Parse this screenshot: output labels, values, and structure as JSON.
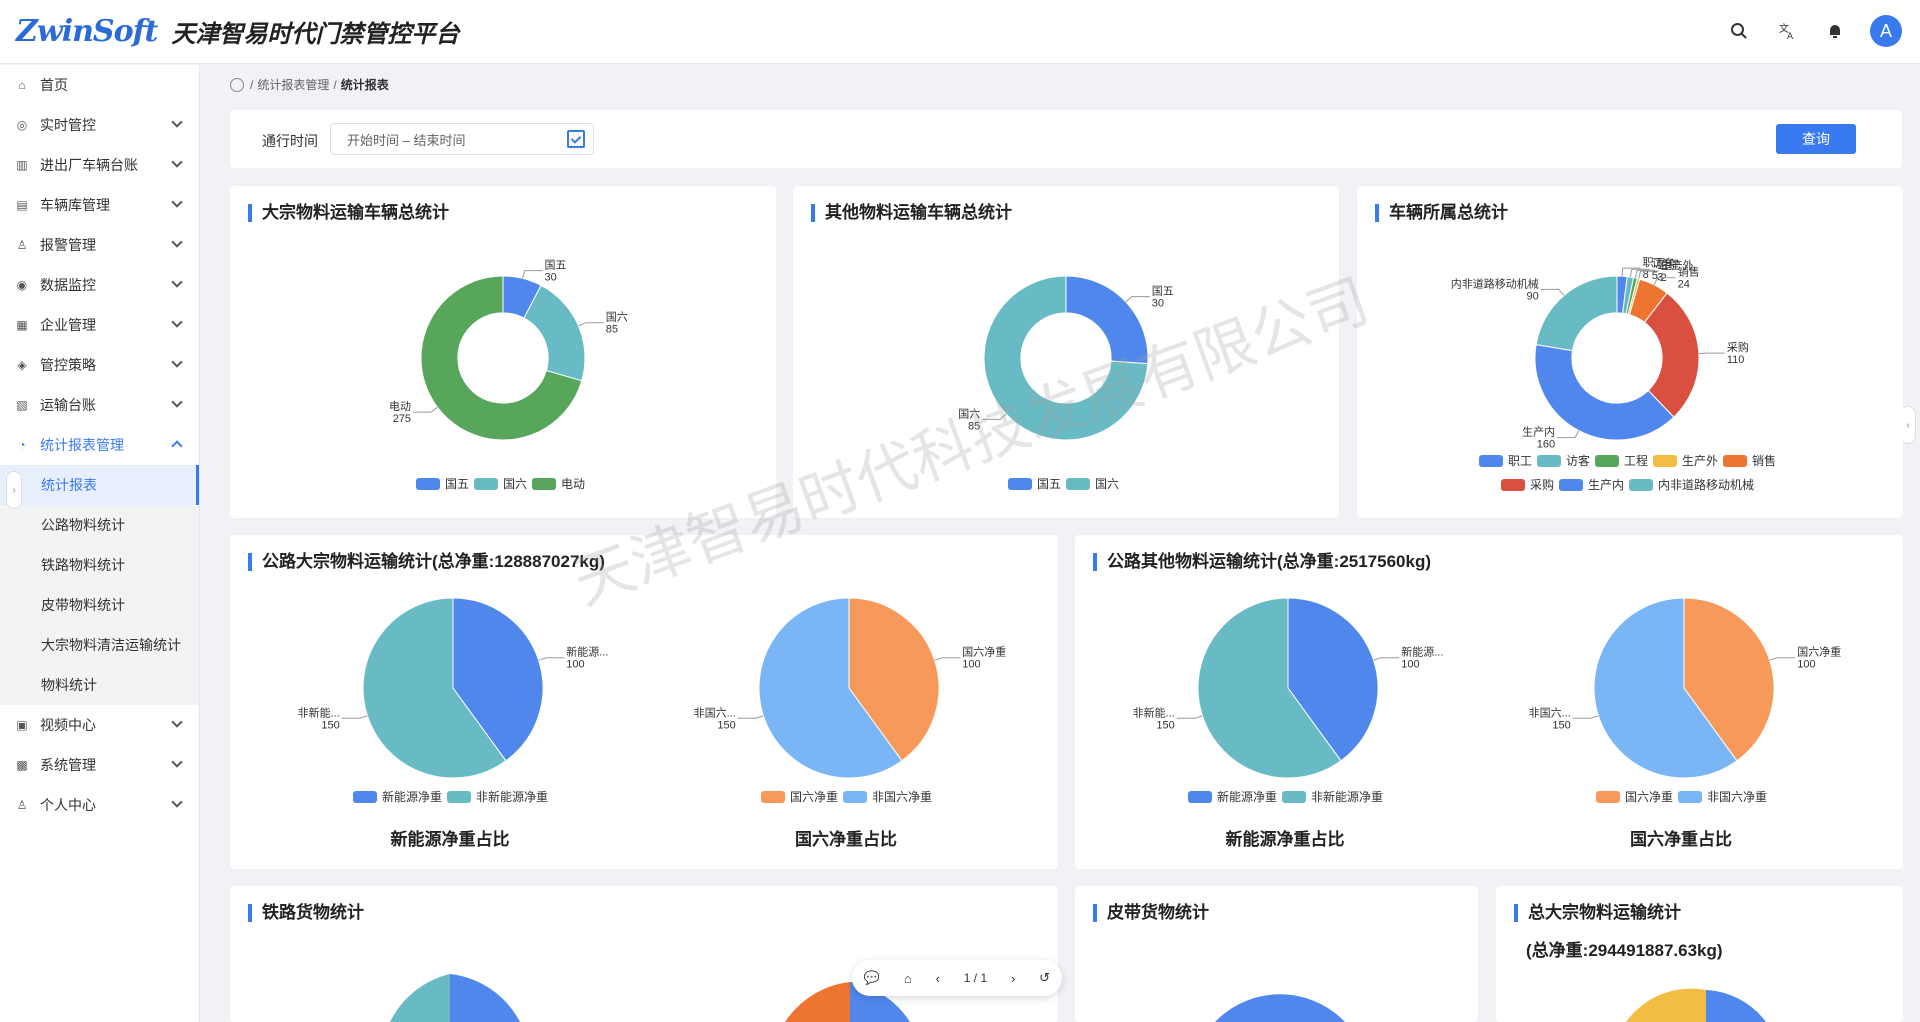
{
  "header": {
    "logo_text": "ZwinSoft",
    "title": "天津智易时代门禁管控平台",
    "avatar_letter": "A",
    "actions": [
      {
        "name": "search-icon",
        "glyph": "⌕"
      },
      {
        "name": "translate-icon",
        "glyph": "文"
      },
      {
        "name": "bell-icon",
        "glyph": "♪"
      }
    ]
  },
  "sidebar": {
    "items": [
      {
        "label": "首页",
        "icon": "⌂",
        "icon_name": "home-icon",
        "has_children": false
      },
      {
        "label": "实时管控",
        "icon": "◎",
        "icon_name": "monitor-icon",
        "has_children": true
      },
      {
        "label": "进出厂车辆台账",
        "icon": "▥",
        "icon_name": "ledger-icon",
        "has_children": true
      },
      {
        "label": "车辆库管理",
        "icon": "▤",
        "icon_name": "vehicle-db-icon",
        "has_children": true
      },
      {
        "label": "报警管理",
        "icon": "♙",
        "icon_name": "alarm-icon",
        "has_children": true
      },
      {
        "label": "数据监控",
        "icon": "◉",
        "icon_name": "data-monitor-icon",
        "has_children": true
      },
      {
        "label": "企业管理",
        "icon": "▦",
        "icon_name": "enterprise-icon",
        "has_children": true
      },
      {
        "label": "管控策略",
        "icon": "◈",
        "icon_name": "strategy-icon",
        "has_children": true
      },
      {
        "label": "运输台账",
        "icon": "▧",
        "icon_name": "transport-ledger-icon",
        "has_children": true
      },
      {
        "label": "统计报表管理",
        "icon": "◔",
        "icon_name": "report-icon",
        "has_children": true,
        "open": true
      }
    ],
    "subitems": [
      {
        "label": "统计报表",
        "active": true
      },
      {
        "label": "公路物料统计"
      },
      {
        "label": "铁路物料统计"
      },
      {
        "label": "皮带物料统计"
      },
      {
        "label": "大宗物料清洁运输统计"
      },
      {
        "label": "物料统计"
      }
    ],
    "bottom_items": [
      {
        "label": "视频中心",
        "icon": "▣",
        "icon_name": "video-icon"
      },
      {
        "label": "系统管理",
        "icon": "▩",
        "icon_name": "system-icon"
      },
      {
        "label": "个人中心",
        "icon": "♙",
        "icon_name": "user-icon"
      }
    ]
  },
  "breadcrumb": {
    "parent": "统计报表管理",
    "current": "统计报表",
    "sep": "/"
  },
  "search": {
    "label": "通行时间",
    "placeholder": "开始时间 – 结束时间",
    "button": "查询"
  },
  "cards": {
    "bulk_vehicles": {
      "title": "大宗物料运输车辆总统计"
    },
    "other_vehicles": {
      "title": "其他物料运输车辆总统计"
    },
    "ownership": {
      "title": "车辆所属总统计"
    },
    "road_bulk": {
      "title": "公路大宗物料运输统计(总净重:128887027kg)",
      "captions": [
        "新能源净重占比",
        "国六净重占比"
      ]
    },
    "road_other": {
      "title": "公路其他物料运输统计(总净重:2517560kg)",
      "captions": [
        "新能源净重占比",
        "国六净重占比"
      ]
    },
    "rail": {
      "title": "铁路货物统计"
    },
    "belt": {
      "title": "皮带货物统计"
    },
    "total_bulk": {
      "title": "总大宗物料运输统计",
      "subtitle": "(总净重:294491887.63kg)"
    }
  },
  "watermark": "天津智易时代科技发展有限公司",
  "pdf_toolbar": {
    "page": "1 / 1"
  },
  "chart_data": [
    {
      "type": "pie",
      "donut": true,
      "categories": [
        "国五",
        "国六",
        "电动"
      ],
      "values": [
        30,
        85,
        275
      ],
      "colors": [
        "#5087ec",
        "#68bbc4",
        "#58a55c"
      ]
    },
    {
      "type": "pie",
      "donut": true,
      "categories": [
        "国五",
        "国六"
      ],
      "values": [
        30,
        85
      ],
      "colors": [
        "#5087ec",
        "#68bbc4"
      ]
    },
    {
      "type": "pie",
      "donut": true,
      "categories": [
        "职工",
        "访客",
        "工程",
        "生产外",
        "销售",
        "采购",
        "生产内",
        "内非道路移动机械"
      ],
      "values": [
        8,
        5,
        3,
        2,
        24,
        110,
        160,
        90
      ],
      "colors": [
        "#5087ec",
        "#68bbc4",
        "#58a55c",
        "#f2bd42",
        "#ee752f",
        "#d95040",
        "#5087ec",
        "#68bbc4"
      ]
    },
    {
      "type": "pie",
      "categories": [
        "新能源净重",
        "非新能源净重"
      ],
      "labels": [
        "新能源...",
        "非新能..."
      ],
      "values": [
        100,
        150
      ],
      "colors": [
        "#5087ec",
        "#68bbc4"
      ]
    },
    {
      "type": "pie",
      "categories": [
        "国六净重",
        "非国六净重"
      ],
      "labels": [
        "国六净重",
        "非国六..."
      ],
      "values": [
        100,
        150
      ],
      "colors": [
        "#f7995b",
        "#7ab5f5"
      ]
    },
    {
      "type": "pie",
      "categories": [
        "新能源净重",
        "非新能源净重"
      ],
      "labels": [
        "新能源...",
        "非新能..."
      ],
      "values": [
        100,
        150
      ],
      "colors": [
        "#5087ec",
        "#68bbc4"
      ]
    },
    {
      "type": "pie",
      "categories": [
        "国六净重",
        "非国六净重"
      ],
      "labels": [
        "国六净重",
        "非国六..."
      ],
      "values": [
        100,
        150
      ],
      "colors": [
        "#f7995b",
        "#7ab5f5"
      ]
    }
  ]
}
